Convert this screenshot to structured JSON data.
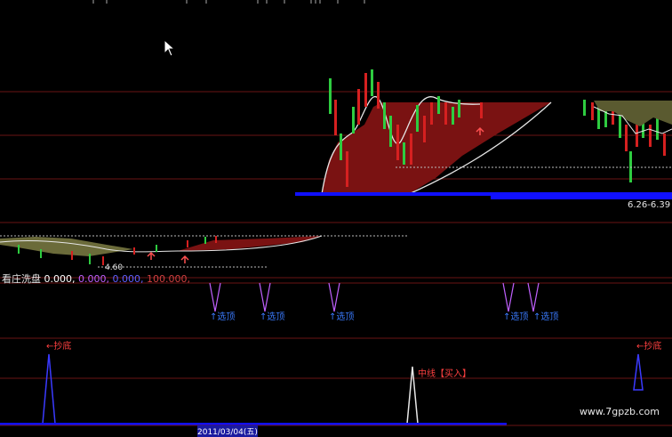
{
  "colors": {
    "background": "#000000",
    "grid_line": "#7a1a1a",
    "dashed_line": "#aaaaaa",
    "up_candle": "#2ecc40",
    "down_candle": "#d62020",
    "shade_area": "#8b1a1a",
    "olive_area": "#6b6b3a",
    "blue_line": "#1010ff",
    "cyan_label": "#3a7bff",
    "pink_label": "#ff4040",
    "white_line": "#e6e6e6"
  },
  "main_panel": {
    "price_range_label": "6.26-6.39",
    "low_label": "4.60"
  },
  "indicator_panel": {
    "title": "看庄洗盘",
    "values": [
      "0.000,",
      "0.000,",
      "0.000,",
      "100.000,"
    ],
    "value_colors": [
      "#ffffff",
      "#c060ff",
      "#6060ff",
      "#d04040"
    ],
    "select_top_label": "↑选顶"
  },
  "signal_panel": {
    "bottom_label": "←抄底",
    "mid_buy_label": "中线【买入】"
  },
  "status_bar": {
    "date_label": "2011/03/04(五)"
  },
  "watermark": "www.7gpzb.com",
  "icons": {
    "cursor": "mouse-pointer-icon",
    "buy_arrow": "up-arrow-icon"
  }
}
